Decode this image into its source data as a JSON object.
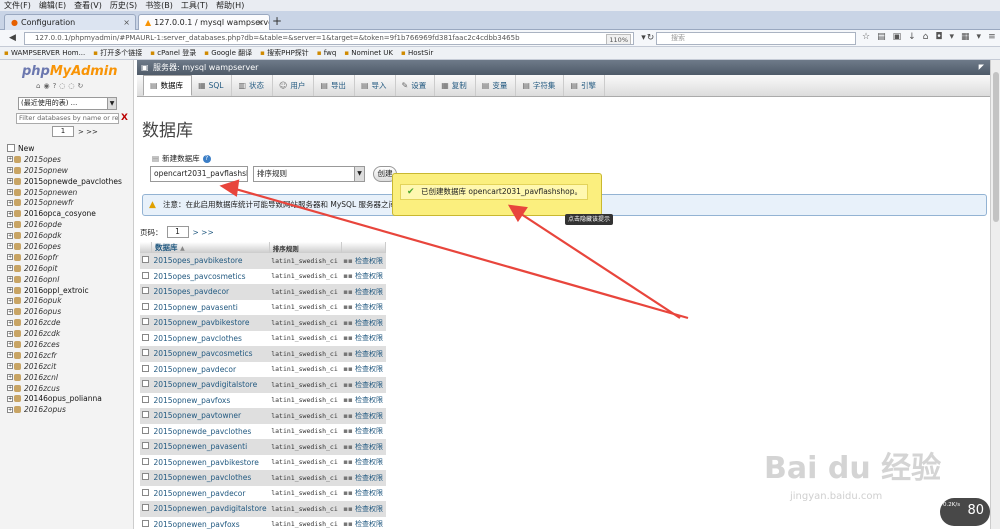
{
  "browser": {
    "menu": [
      "文件(F)",
      "编辑(E)",
      "查看(V)",
      "历史(S)",
      "书签(B)",
      "工具(T)",
      "帮助(H)"
    ],
    "tabs": [
      {
        "label": "Configuration",
        "close": "×"
      },
      {
        "label": "127.0.0.1 / mysql wampserver | ph",
        "close": "×"
      }
    ],
    "new_tab": "+",
    "url": "127.0.0.1/phpmyadmin/#PMAURL-1:server_databases.php?db=&table=&server=1&target=&token=9f1b766969fd381faac2c4cdbb3465b",
    "zoom": "110%",
    "search_placeholder": "搜索",
    "bookmarks": [
      "WAMPSERVER Hom...",
      "打开多个链接",
      "cPanel 登录",
      "Google 翻译",
      "搜索PHP探针",
      "fwq",
      "Nominet UK",
      "HostSir"
    ]
  },
  "sidebar": {
    "logo_php": "php",
    "logo_ma": "MyAdmin",
    "recent_select": "(最近使用的表) ...",
    "filter_placeholder": "Filter databases by name or reg",
    "filter_clear": "X",
    "pager_value": "1",
    "pager_next": "> >>",
    "new_label": "New",
    "databases": [
      {
        "name": "2015opes",
        "italic": true
      },
      {
        "name": "2015opnew",
        "italic": true
      },
      {
        "name": "2015opnewde_pavclothes",
        "italic": false
      },
      {
        "name": "2015opnewen",
        "italic": true
      },
      {
        "name": "2015opnewfr",
        "italic": true
      },
      {
        "name": "2016opca_cosyone",
        "italic": false
      },
      {
        "name": "2016opde",
        "italic": true
      },
      {
        "name": "2016opdk",
        "italic": true
      },
      {
        "name": "2016opes",
        "italic": true
      },
      {
        "name": "2016opfr",
        "italic": true
      },
      {
        "name": "2016opit",
        "italic": true
      },
      {
        "name": "2016opnl",
        "italic": true
      },
      {
        "name": "2016oppl_extroic",
        "italic": false
      },
      {
        "name": "2016opuk",
        "italic": true
      },
      {
        "name": "2016opus",
        "italic": true
      },
      {
        "name": "2016zcde",
        "italic": true
      },
      {
        "name": "2016zcdk",
        "italic": true
      },
      {
        "name": "2016zces",
        "italic": true
      },
      {
        "name": "2016zcfr",
        "italic": true
      },
      {
        "name": "2016zcit",
        "italic": true
      },
      {
        "name": "2016zcnl",
        "italic": true
      },
      {
        "name": "2016zcus",
        "italic": true
      },
      {
        "name": "20146opus_polianna",
        "italic": false
      },
      {
        "name": "20162opus",
        "italic": true
      }
    ]
  },
  "main": {
    "server_label": "服务器: mysql wampserver",
    "tabs": [
      {
        "label": "数据库",
        "icon": "▤",
        "active": true
      },
      {
        "label": "SQL",
        "icon": "▦",
        "active": false
      },
      {
        "label": "状态",
        "icon": "▥",
        "active": false
      },
      {
        "label": "用户",
        "icon": "☺",
        "active": false
      },
      {
        "label": "导出",
        "icon": "▤",
        "active": false
      },
      {
        "label": "导入",
        "icon": "▤",
        "active": false
      },
      {
        "label": "设置",
        "icon": "✎",
        "active": false
      },
      {
        "label": "复制",
        "icon": "▦",
        "active": false
      },
      {
        "label": "变量",
        "icon": "▤",
        "active": false
      },
      {
        "label": "字符集",
        "icon": "▤",
        "active": false
      },
      {
        "label": "引擎",
        "icon": "▤",
        "active": false
      }
    ],
    "page_title": "数据库",
    "new_db_label": "新建数据库",
    "new_db_value": "opencart2031_pavflashshop",
    "collation_value": "排序规则",
    "create_button": "创建",
    "notice": "注意：在此启用数据库统计可能导致网站服务器和 MySQL 服务器之间",
    "pager_label": "页码：",
    "pager_value": "1",
    "pager_next": "> >>",
    "table": {
      "col_db": "数据库",
      "sort_arrow": "▲",
      "col_collation": "排序规则",
      "rows": [
        {
          "name": "2015opes_pavbikestore",
          "collation": "latin1_swedish_ci",
          "privs": "检查权限"
        },
        {
          "name": "2015opes_pavcosmetics",
          "collation": "latin1_swedish_ci",
          "privs": "检查权限"
        },
        {
          "name": "2015opes_pavdecor",
          "collation": "latin1_swedish_ci",
          "privs": "检查权限"
        },
        {
          "name": "2015opnew_pavasenti",
          "collation": "latin1_swedish_ci",
          "privs": "检查权限"
        },
        {
          "name": "2015opnew_pavbikestore",
          "collation": "latin1_swedish_ci",
          "privs": "检查权限"
        },
        {
          "name": "2015opnew_pavclothes",
          "collation": "latin1_swedish_ci",
          "privs": "检查权限"
        },
        {
          "name": "2015opnew_pavcosmetics",
          "collation": "latin1_swedish_ci",
          "privs": "检查权限"
        },
        {
          "name": "2015opnew_pavdecor",
          "collation": "latin1_swedish_ci",
          "privs": "检查权限"
        },
        {
          "name": "2015opnew_pavdigitalstore",
          "collation": "latin1_swedish_ci",
          "privs": "检查权限"
        },
        {
          "name": "2015opnew_pavfoxs",
          "collation": "latin1_swedish_ci",
          "privs": "检查权限"
        },
        {
          "name": "2015opnew_pavtowner",
          "collation": "latin1_swedish_ci",
          "privs": "检查权限"
        },
        {
          "name": "2015opnewde_pavclothes",
          "collation": "latin1_swedish_ci",
          "privs": "检查权限"
        },
        {
          "name": "2015opnewen_pavasenti",
          "collation": "latin1_swedish_ci",
          "privs": "检查权限"
        },
        {
          "name": "2015opnewen_pavbikestore",
          "collation": "latin1_swedish_ci",
          "privs": "检查权限"
        },
        {
          "name": "2015opnewen_pavclothes",
          "collation": "latin1_swedish_ci",
          "privs": "检查权限"
        },
        {
          "name": "2015opnewen_pavdecor",
          "collation": "latin1_swedish_ci",
          "privs": "检查权限"
        },
        {
          "name": "2015opnewen_pavdigitalstore",
          "collation": "latin1_swedish_ci",
          "privs": "检查权限"
        },
        {
          "name": "2015opnewen_pavfoxs",
          "collation": "latin1_swedish_ci",
          "privs": "检查权限"
        }
      ]
    },
    "toast": "已创建数据库 opencart2031_pavflashshop。",
    "tooltip": "点击隐藏该提示"
  },
  "overlay": {
    "watermark": "Bai du 经验",
    "watermark_url": "jingyan.baidu.com",
    "speed": "0.2K/s",
    "percent": "80"
  },
  "colors": {
    "link": "#235a81",
    "annotation_arrow": "#e8453c",
    "toast_bg": "#fbef7e"
  }
}
